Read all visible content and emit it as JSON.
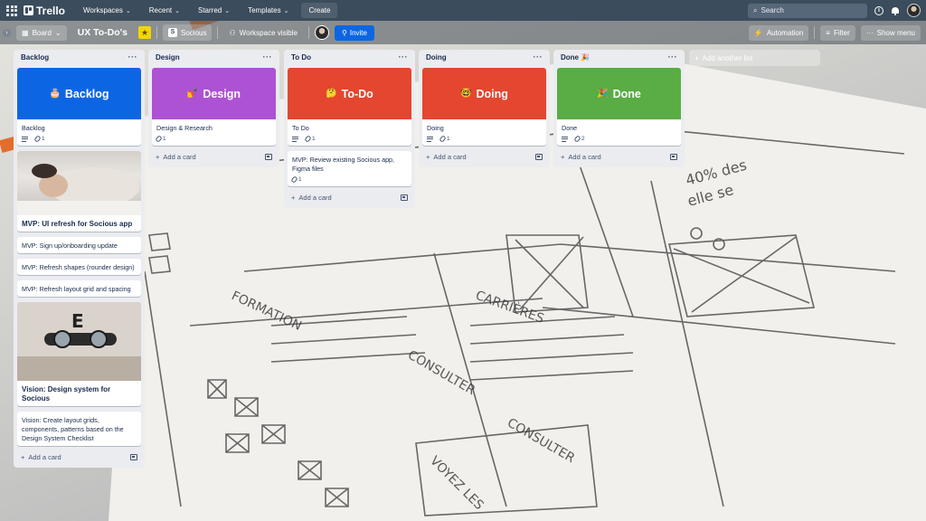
{
  "topbar": {
    "app_name": "Trello",
    "menus": [
      {
        "label": "Workspaces"
      },
      {
        "label": "Recent"
      },
      {
        "label": "Starred"
      },
      {
        "label": "Templates"
      }
    ],
    "create_label": "Create",
    "search_placeholder": "Search"
  },
  "boardbar": {
    "view_label": "Board",
    "board_title": "UX To-Do's",
    "workspace_name": "Socious",
    "visibility_label": "Workspace visible",
    "invite_label": "Invite",
    "automation_label": "Automation",
    "filter_label": "Filter",
    "show_menu_label": "Show menu"
  },
  "lists": [
    {
      "title": "Backlog",
      "cards": [
        {
          "cover_text": "Backlog",
          "cover_emoji": "🎂",
          "cover_color": "#0c66e4",
          "title": "Backlog",
          "has_description": true,
          "attachments": "1"
        },
        {
          "title": "MVP: UI refresh for Socious app",
          "photo": "baby"
        },
        {
          "title": "MVP: Sign up/onboarding update"
        },
        {
          "title": "MVP: Refresh shapes (rounder design)"
        },
        {
          "title": "MVP: Refresh layout grid and spacing"
        },
        {
          "title": "Vision: Design system for Socious",
          "photo": "eye-chart"
        },
        {
          "title": "Vision: Create layout grids, components, patterns based on the Design System Checklist"
        }
      ],
      "add_card_label": "Add a card"
    },
    {
      "title": "Design",
      "cards": [
        {
          "cover_text": "Design",
          "cover_emoji": "💅",
          "cover_color": "#ae52d4",
          "title": "Design & Research",
          "has_description": false,
          "attachments": "1"
        }
      ],
      "add_card_label": "Add a card"
    },
    {
      "title": "To Do",
      "cards": [
        {
          "cover_text": "To-Do",
          "cover_emoji": "🤔",
          "cover_color": "#e4462f",
          "title": "To Do",
          "has_description": true,
          "attachments": "1"
        },
        {
          "title": "MVP: Review existing Socious app, Figma files",
          "attachments": "1"
        }
      ],
      "add_card_label": "Add a card"
    },
    {
      "title": "Doing",
      "cards": [
        {
          "cover_text": "Doing",
          "cover_emoji": "🤓",
          "cover_color": "#e4462f",
          "title": "Doing",
          "has_description": true,
          "attachments": "1"
        }
      ],
      "add_card_label": "Add a card"
    },
    {
      "title": "Done 🎉",
      "cards": [
        {
          "cover_text": "Done",
          "cover_emoji": "🎉",
          "cover_color": "#5aac44",
          "title": "Done",
          "has_description": true,
          "attachments": "2"
        }
      ],
      "add_card_label": "Add a card"
    }
  ],
  "add_list_label": "Add another list",
  "icons": [
    "apps-grid-icon",
    "trello-logo-icon",
    "chevron-down-icon",
    "search-icon",
    "info-icon",
    "bell-icon",
    "avatar",
    "board-icon",
    "star-icon",
    "workspace-icon",
    "visibility-icon",
    "invite-icon",
    "automation-icon",
    "filter-icon",
    "more-icon",
    "description-icon",
    "attachment-icon",
    "plus-icon",
    "card-template-icon"
  ],
  "colors": {
    "topbar": "#3b4c5c",
    "list_bg": "#ebecf0",
    "invite": "#0c66e4",
    "star": "#f2d600"
  }
}
